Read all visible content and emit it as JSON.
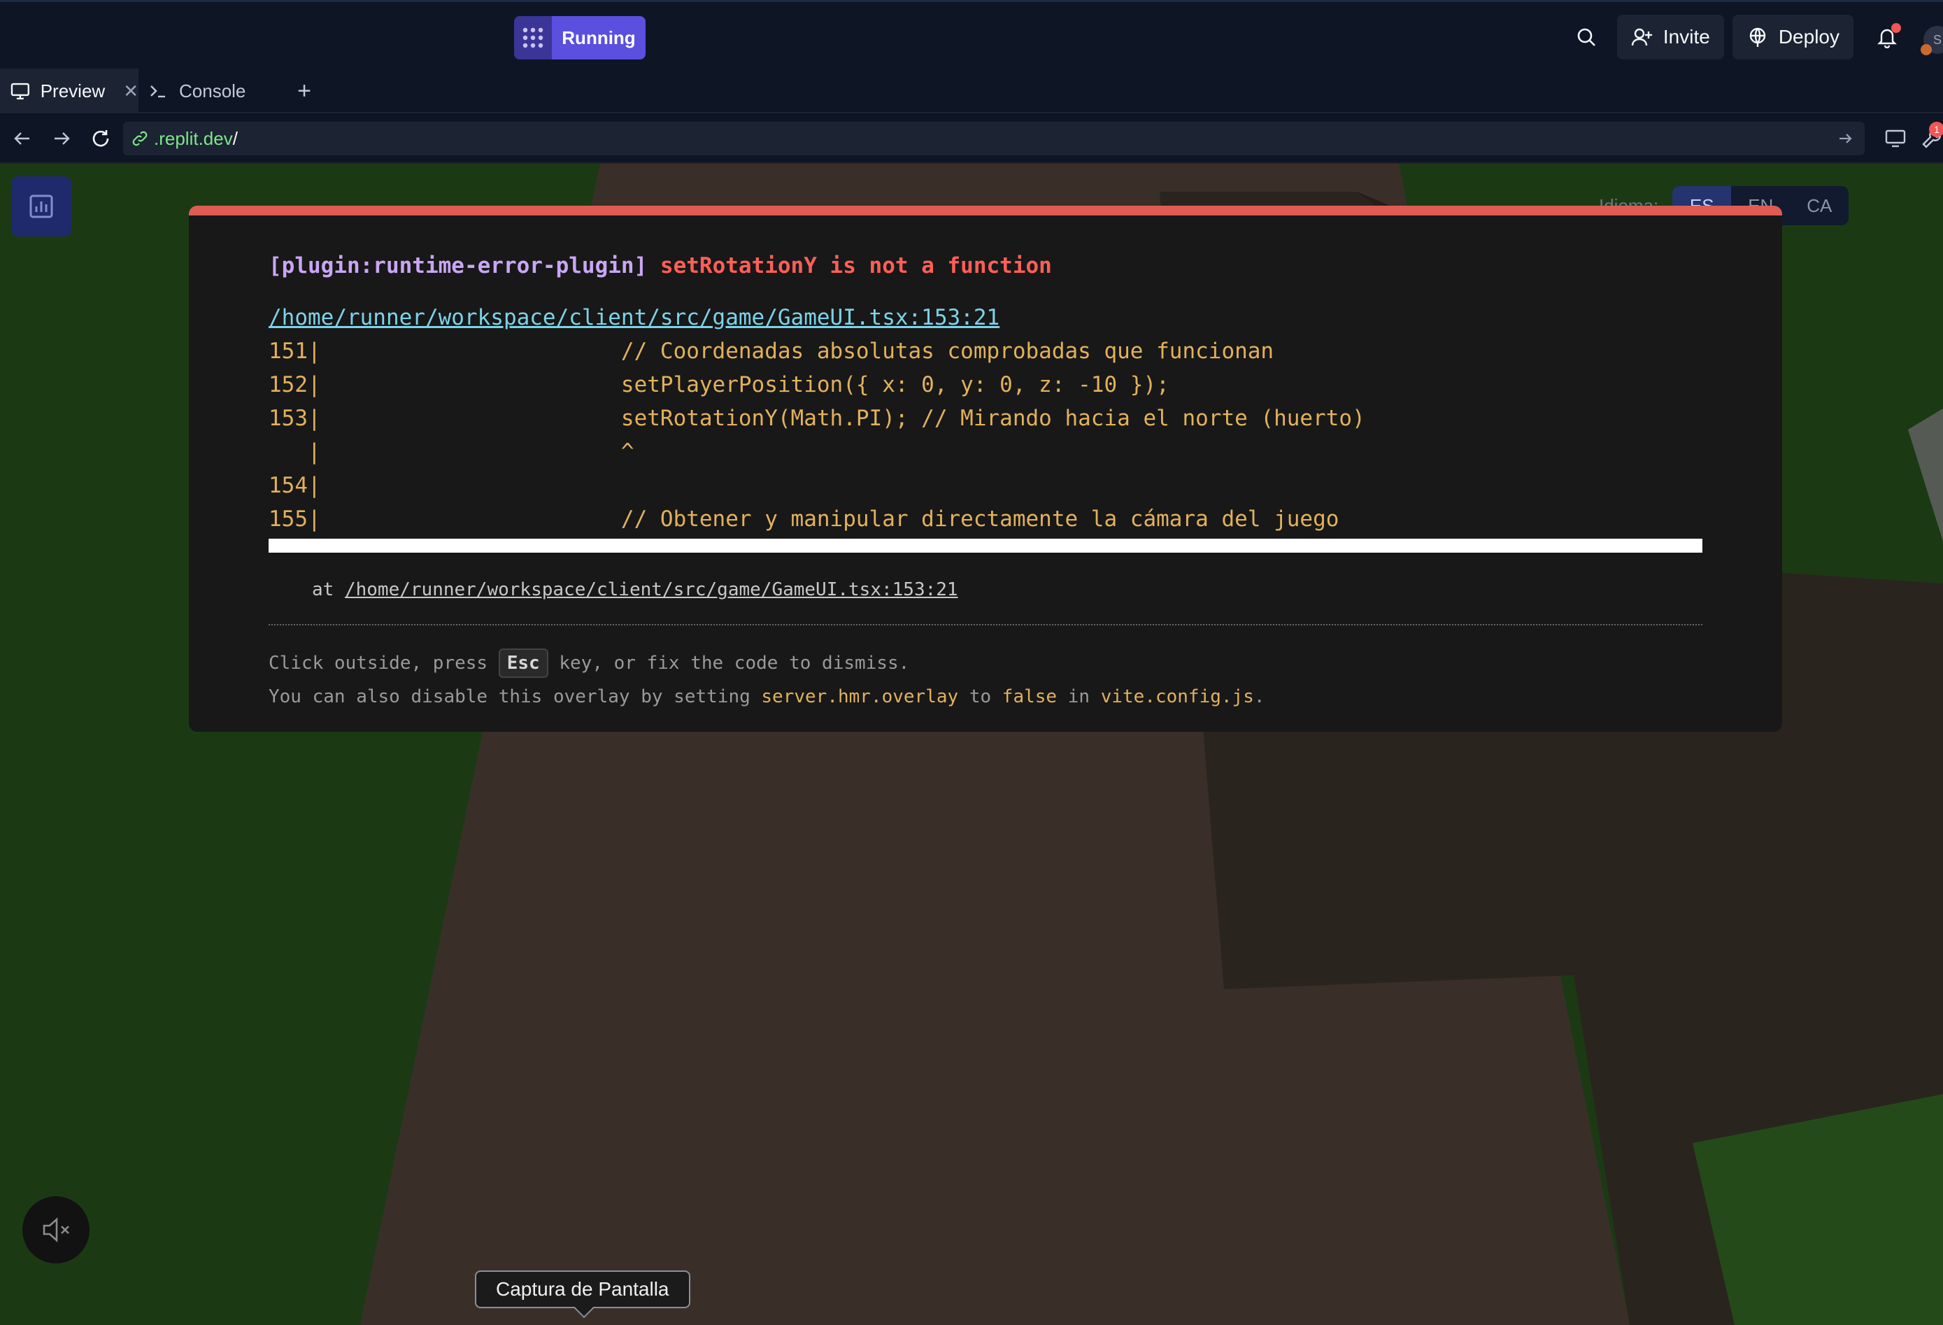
{
  "topbar": {
    "run_label": "Running",
    "invite_label": "Invite",
    "deploy_label": "Deploy",
    "avatar_initial": "S"
  },
  "tabs": [
    {
      "label": "Preview",
      "active": true
    },
    {
      "label": "Console",
      "active": false
    }
  ],
  "addressbar": {
    "url_green": ".replit.dev",
    "url_white": "/",
    "devtools_badge": "1"
  },
  "game": {
    "language_label": "Idioma:",
    "languages": [
      "ES",
      "EN",
      "CA"
    ],
    "selected_language": "ES",
    "tooltip": "Captura de Pantalla"
  },
  "error": {
    "plugin": "[plugin:runtime-error-plugin]",
    "message": "setRotationY is not a function",
    "file": "/home/runner/workspace/client/src/game/GameUI.tsx:153:21",
    "code_lines": [
      "151|                       // Coordenadas absolutas comprobadas que funcionan",
      "152|                       setPlayerPosition({ x: 0, y: 0, z: -10 });",
      "153|                       setRotationY(Math.PI); // Mirando hacia el norte (huerto)",
      "   |                       ^",
      "154|",
      "155|                       // Obtener y manipular directamente la cámara del juego"
    ],
    "trace_prefix": "at ",
    "trace_link": "/home/runner/workspace/client/src/game/GameUI.tsx:153:21",
    "tip1_a": "Click outside, press ",
    "tip1_key": "Esc",
    "tip1_b": " key, or fix the code to dismiss.",
    "tip2_a": "You can also disable this overlay by setting ",
    "tip2_code": "server.hmr.overlay",
    "tip2_b": " to ",
    "tip2_false": "false",
    "tip2_c": " in ",
    "tip2_file": "vite.config.js",
    "tip2_d": "."
  },
  "colors": {
    "accent": "#5b4fe0",
    "error_bar": "#e05b52",
    "code": "#e2b15c",
    "link": "#7dd3e8"
  }
}
